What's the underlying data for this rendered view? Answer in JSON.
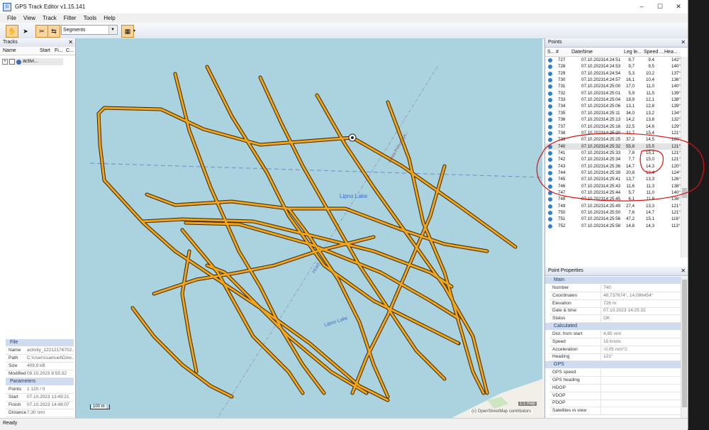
{
  "window": {
    "title": "GPS Track Editor v1.15.141",
    "minimize": "–",
    "maximize": "☐",
    "close": "✕"
  },
  "menu": [
    {
      "label": "File"
    },
    {
      "label": "View"
    },
    {
      "label": "Track"
    },
    {
      "label": "Filter"
    },
    {
      "label": "Tools"
    },
    {
      "label": "Help"
    }
  ],
  "toolbar": {
    "mode_select": "Segments",
    "icons": [
      "hand-tool-icon",
      "pointer-icon",
      "scissors-icon",
      "arrows-icon",
      "split-view-icon"
    ]
  },
  "tracks_panel": {
    "title": "Tracks",
    "close": "✕",
    "columns": [
      "Name",
      "Start",
      "Fi...",
      "C..."
    ],
    "items": [
      {
        "label": "activi..."
      }
    ]
  },
  "file_props": {
    "section_title": "File",
    "rows": [
      {
        "key": "Name",
        "value": "activity_12212176702..."
      },
      {
        "key": "Path",
        "value": "C:\\Users\\samuel\\Dow..."
      },
      {
        "key": "Size",
        "value": "409,9 kB"
      },
      {
        "key": "Modified",
        "value": "09.10.2023 8:55:32"
      }
    ]
  },
  "parameters": {
    "section_title": "Parameters",
    "rows": [
      {
        "key": "Points",
        "value": "1 120 / 0"
      },
      {
        "key": "Start",
        "value": "07.10.2023 13:49:21"
      },
      {
        "key": "Finish",
        "value": "07.10.2023 14:48:07"
      },
      {
        "key": "Distance",
        "value": "7,30 nmi"
      }
    ]
  },
  "map": {
    "labels": [
      "Lipno Lake",
      "Hrad...",
      "Lipno Lake",
      "Cesta Pohumays..."
    ],
    "scale": "100 m",
    "zoom": "1:1 map",
    "attribution": "(c) OpenStreetMap contributors",
    "track_color": "#e8a21c",
    "water_color": "#aad3df"
  },
  "points_panel": {
    "title": "Points",
    "close": "✕",
    "columns": [
      "S...",
      "#",
      "Date/time",
      "Leg le...",
      "Speed ...",
      "Hea..."
    ],
    "rows": [
      {
        "n": "727",
        "date": "07.10.2023",
        "time": "14:24:51",
        "leg": "9,7",
        "speed": "9,4",
        "head": "142°"
      },
      {
        "n": "728",
        "date": "07.10.2023",
        "time": "14:24:53",
        "leg": "9,7",
        "speed": "9,5",
        "head": "140°"
      },
      {
        "n": "729",
        "date": "07.10.2023",
        "time": "14:24:54",
        "leg": "5,3",
        "speed": "10,2",
        "head": "137°"
      },
      {
        "n": "730",
        "date": "07.10.2023",
        "time": "14:24:57",
        "leg": "16,1",
        "speed": "10,4",
        "head": "136°"
      },
      {
        "n": "731",
        "date": "07.10.2023",
        "time": "14:25:00",
        "leg": "17,0",
        "speed": "11,0",
        "head": "140°"
      },
      {
        "n": "732",
        "date": "07.10.2023",
        "time": "14:25:01",
        "leg": "5,9",
        "speed": "11,5",
        "head": "139°"
      },
      {
        "n": "733",
        "date": "07.10.2023",
        "time": "14:25:04",
        "leg": "18,9",
        "speed": "12,1",
        "head": "138°"
      },
      {
        "n": "734",
        "date": "07.10.2023",
        "time": "14:25:06",
        "leg": "13,1",
        "speed": "12,8",
        "head": "139°"
      },
      {
        "n": "735",
        "date": "07.10.2023",
        "time": "14:25:11",
        "leg": "34,0",
        "speed": "13,2",
        "head": "134°"
      },
      {
        "n": "736",
        "date": "07.10.2023",
        "time": "14:25:13",
        "leg": "14,2",
        "speed": "13,8",
        "head": "132°"
      },
      {
        "n": "737",
        "date": "07.10.2023",
        "time": "14:25:16",
        "leg": "22,5",
        "speed": "14,6",
        "head": "129°"
      },
      {
        "n": "738",
        "date": "07.10.2023",
        "time": "14:25:20",
        "leg": "31,7",
        "speed": "15,4",
        "head": "121°"
      },
      {
        "n": "739",
        "date": "07.10.2023",
        "time": "14:25:25",
        "leg": "37,2",
        "speed": "14,5",
        "head": "120°"
      },
      {
        "n": "740",
        "date": "07.10.2023",
        "time": "14:25:32",
        "leg": "55,8",
        "speed": "15,5",
        "head": "121°"
      },
      {
        "n": "741",
        "date": "07.10.2023",
        "time": "14:25:33",
        "leg": "7,8",
        "speed": "15,1",
        "head": "121°"
      },
      {
        "n": "742",
        "date": "07.10.2023",
        "time": "14:25:34",
        "leg": "7,7",
        "speed": "15,0",
        "head": "121°"
      },
      {
        "n": "743",
        "date": "07.10.2023",
        "time": "14:25:36",
        "leg": "14,7",
        "speed": "14,3",
        "head": "120°"
      },
      {
        "n": "744",
        "date": "07.10.2023",
        "time": "14:25:39",
        "leg": "20,8",
        "speed": "13,4",
        "head": "124°"
      },
      {
        "n": "745",
        "date": "07.10.2023",
        "time": "14:25:41",
        "leg": "13,7",
        "speed": "13,3",
        "head": "126°"
      },
      {
        "n": "746",
        "date": "07.10.2023",
        "time": "14:25:43",
        "leg": "11,6",
        "speed": "11,3",
        "head": "138°"
      },
      {
        "n": "747",
        "date": "07.10.2023",
        "time": "14:25:44",
        "leg": "5,7",
        "speed": "11,0",
        "head": "140°"
      },
      {
        "n": "748",
        "date": "07.10.2023",
        "time": "14:25:45",
        "leg": "6,1",
        "speed": "11,9",
        "head": "136°"
      },
      {
        "n": "749",
        "date": "07.10.2023",
        "time": "14:25:49",
        "leg": "27,4",
        "speed": "13,3",
        "head": "121°"
      },
      {
        "n": "750",
        "date": "07.10.2023",
        "time": "14:25:50",
        "leg": "7,6",
        "speed": "14,7",
        "head": "121°"
      },
      {
        "n": "751",
        "date": "07.10.2023",
        "time": "14:25:56",
        "leg": "47,2",
        "speed": "15,1",
        "head": "116°"
      },
      {
        "n": "752",
        "date": "07.10.2023",
        "time": "14:25:58",
        "leg": "14,8",
        "speed": "14,3",
        "head": "113°"
      }
    ]
  },
  "point_properties": {
    "title": "Point Properties",
    "close": "✕",
    "sections": [
      {
        "title": "Main",
        "rows": [
          {
            "key": "Number",
            "value": "740"
          },
          {
            "key": "Coordinates",
            "value": "48,737674°, 14,086454°"
          },
          {
            "key": "Elevation",
            "value": "726 m"
          },
          {
            "key": "Date & time",
            "value": "07.10.2023 14:25:32"
          },
          {
            "key": "Status",
            "value": "OK"
          }
        ]
      },
      {
        "title": "Calculated",
        "rows": [
          {
            "key": "Dist. from start",
            "value": "4,85 nmi"
          },
          {
            "key": "Speed",
            "value": "15 knots"
          },
          {
            "key": "Acceleration",
            "value": "-0,05 m/s^2"
          },
          {
            "key": "Heading",
            "value": "121°"
          }
        ]
      },
      {
        "title": "GPS",
        "rows": [
          {
            "key": "GPS speed",
            "value": ""
          },
          {
            "key": "GPS heading",
            "value": ""
          },
          {
            "key": "HDOP",
            "value": ""
          },
          {
            "key": "VDOP",
            "value": ""
          },
          {
            "key": "PDOP",
            "value": ""
          },
          {
            "key": "Satellites in view",
            "value": ""
          }
        ]
      }
    ]
  },
  "status": "Ready"
}
